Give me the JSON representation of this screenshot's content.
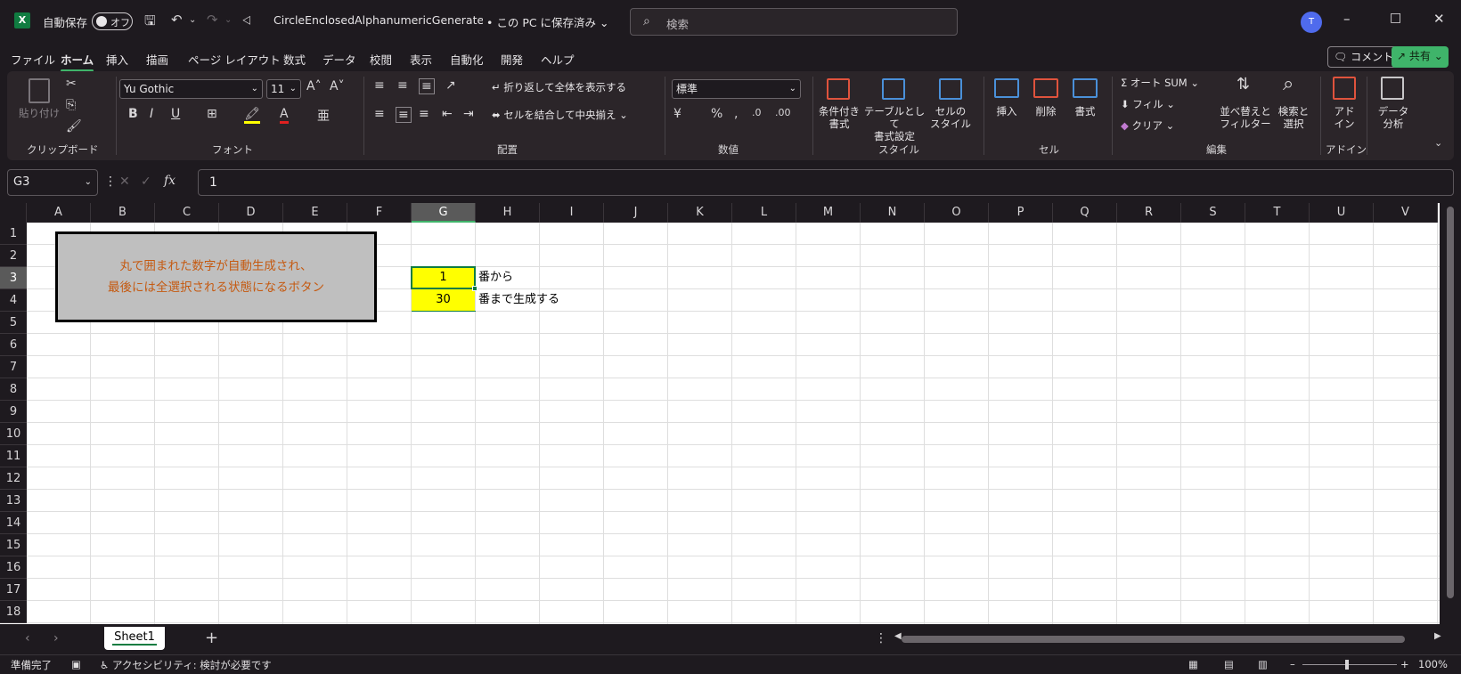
{
  "titlebar": {
    "autosave_label": "自動保存",
    "autosave_state": "オフ",
    "filename": "CircleEnclosedAlphanumericGenerater.···",
    "save_status": "• この PC に保存済み ⌄",
    "search_placeholder": "検索",
    "user_initial": "T"
  },
  "menu": {
    "items": [
      "ファイル",
      "ホーム",
      "挿入",
      "描画",
      "ページ レイアウト",
      "数式",
      "データ",
      "校閲",
      "表示",
      "自動化",
      "開発",
      "ヘルプ"
    ],
    "comment_label": "コメント",
    "share_label": "共有"
  },
  "ribbon": {
    "clipboard": {
      "paste": "貼り付け",
      "group": "クリップボード"
    },
    "font": {
      "name": "Yu Gothic",
      "size": "11",
      "group": "フォント"
    },
    "alignment": {
      "wrap": "折り返して全体を表示する",
      "merge": "セルを結合して中央揃え",
      "group": "配置"
    },
    "number": {
      "format": "標準",
      "group": "数値"
    },
    "styles": {
      "conditional": "条件付き\n書式",
      "table": "テーブルとして\n書式設定",
      "cell": "セルの\nスタイル",
      "group": "スタイル"
    },
    "cells": {
      "insert": "挿入",
      "delete": "削除",
      "format": "書式",
      "group": "セル"
    },
    "editing": {
      "autosum": "オート SUM",
      "fill": "フィル",
      "clear": "クリア",
      "sort": "並べ替えと\nフィルター",
      "find": "検索と\n選択",
      "group": "編集"
    },
    "addins": {
      "addin": "アド\nイン",
      "group": "アドイン"
    },
    "analysis": {
      "label": "データ\n分析"
    }
  },
  "formula_bar": {
    "name_box": "G3",
    "value": "1"
  },
  "columns": [
    "A",
    "B",
    "C",
    "D",
    "E",
    "F",
    "G",
    "H",
    "I",
    "J",
    "K",
    "L",
    "M",
    "N",
    "O",
    "P",
    "Q",
    "R",
    "S",
    "T",
    "U",
    "V"
  ],
  "rows": [
    "1",
    "2",
    "3",
    "4",
    "5",
    "6",
    "7",
    "8",
    "9",
    "10",
    "11",
    "12",
    "13",
    "14",
    "15",
    "16",
    "17",
    "18"
  ],
  "cells": {
    "G3": "1",
    "H3": "番から",
    "G4": "30",
    "H4": "番まで生成する"
  },
  "shape_button": {
    "line1": "丸で囲まれた数字が自動生成され、",
    "line2": "最後には全選択される状態になるボタン"
  },
  "sheet_tabs": [
    "Sheet1"
  ],
  "status": {
    "ready": "準備完了",
    "accessibility": "アクセシビリティ: 検討が必要です",
    "zoom": "100%"
  },
  "colors": {
    "accent": "#107c41",
    "highlight": "#ffff00",
    "button_text": "#c55a11"
  }
}
